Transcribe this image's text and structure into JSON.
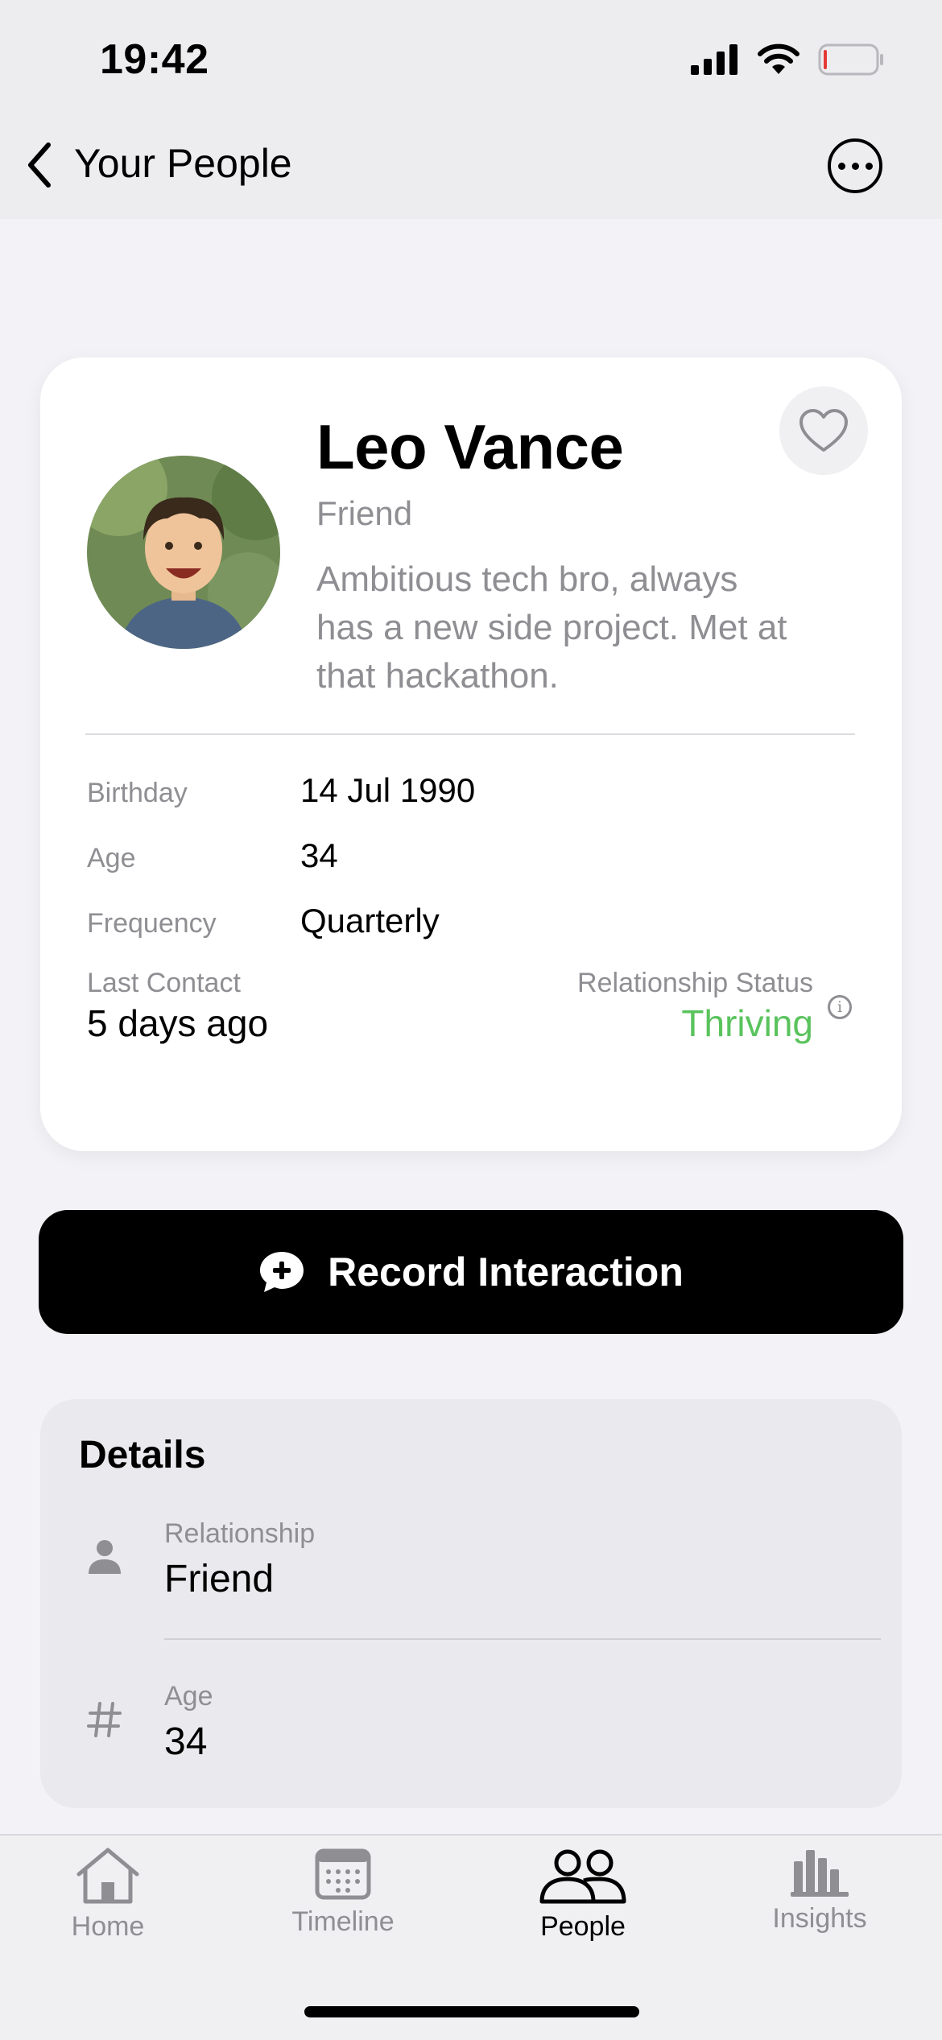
{
  "status_bar": {
    "time": "19:42"
  },
  "nav": {
    "back_label": "Your People"
  },
  "profile": {
    "name": "Leo Vance",
    "role": "Friend",
    "bio": "Ambitious tech bro, always has a new side project. Met at that hackathon.",
    "info": [
      {
        "label": "Birthday",
        "value": "14 Jul 1990"
      },
      {
        "label": "Age",
        "value": "34"
      },
      {
        "label": "Frequency",
        "value": "Quarterly"
      }
    ],
    "last_contact": {
      "label": "Last Contact",
      "value": "5 days ago"
    },
    "relationship_status": {
      "label": "Relationship Status",
      "value": "Thriving",
      "color": "#5ac35d"
    }
  },
  "record_button": {
    "label": "Record Interaction"
  },
  "details": {
    "title": "Details",
    "rows": [
      {
        "icon": "person-icon",
        "label": "Relationship",
        "value": "Friend"
      },
      {
        "icon": "hash-icon",
        "label": "Age",
        "value": "34"
      }
    ]
  },
  "tabbar": {
    "tabs": [
      {
        "label": "Home",
        "icon": "house-icon",
        "active": false
      },
      {
        "label": "Timeline",
        "icon": "calendar-icon",
        "active": false
      },
      {
        "label": "People",
        "icon": "people-icon",
        "active": true
      },
      {
        "label": "Insights",
        "icon": "bar-chart-icon",
        "active": false
      }
    ]
  }
}
